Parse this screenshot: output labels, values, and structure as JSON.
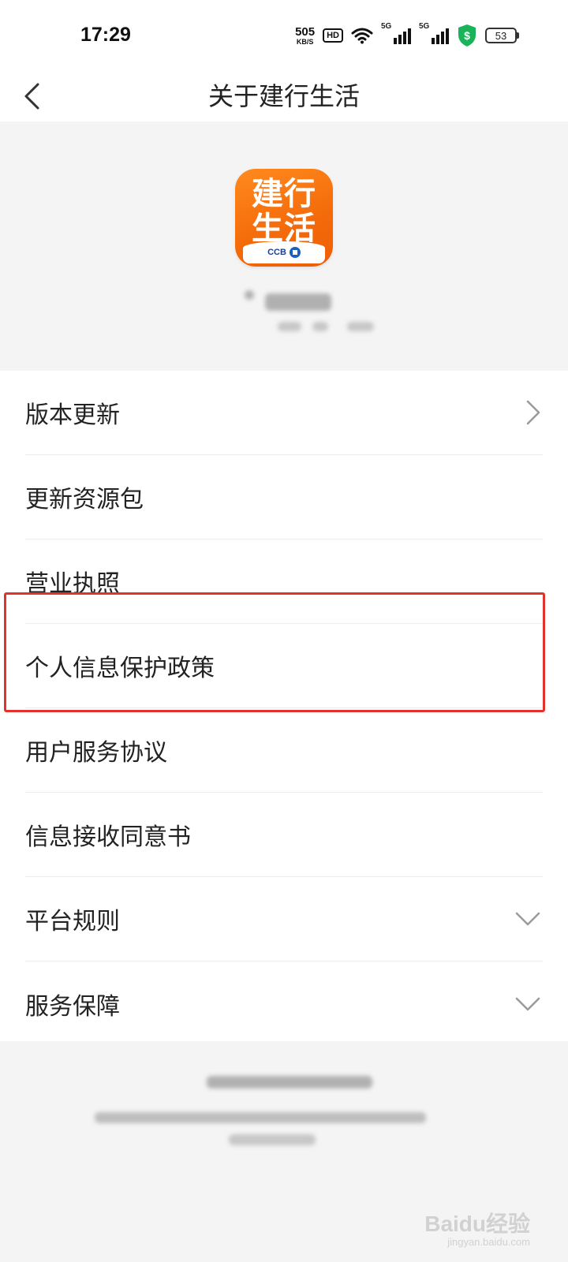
{
  "status_bar": {
    "time": "17:29",
    "net_speed": "505",
    "net_unit": "KB/S",
    "hd_badge": "HD",
    "signal_1_label": "5G",
    "signal_2_label": "5G",
    "battery": "53"
  },
  "nav": {
    "title": "关于建行生活"
  },
  "app_icon": {
    "name_line1": "建行",
    "name_line2": "生活",
    "bank_mark": "CCB"
  },
  "menu": {
    "items": [
      {
        "label": "版本更新",
        "accessory": "chevron-right"
      },
      {
        "label": "更新资源包",
        "accessory": "none"
      },
      {
        "label": "营业执照",
        "accessory": "none"
      },
      {
        "label": "个人信息保护政策",
        "accessory": "none"
      },
      {
        "label": "用户服务协议",
        "accessory": "none"
      },
      {
        "label": "信息接收同意书",
        "accessory": "none"
      },
      {
        "label": "平台规则",
        "accessory": "chevron-down"
      },
      {
        "label": "服务保障",
        "accessory": "chevron-down"
      }
    ]
  },
  "watermark": {
    "logo": "Baidu经验",
    "url": "jingyan.baidu.com"
  },
  "colors": {
    "accent": "#f46a0a",
    "highlight_border": "#e0332b",
    "background": "#f4f4f4"
  }
}
